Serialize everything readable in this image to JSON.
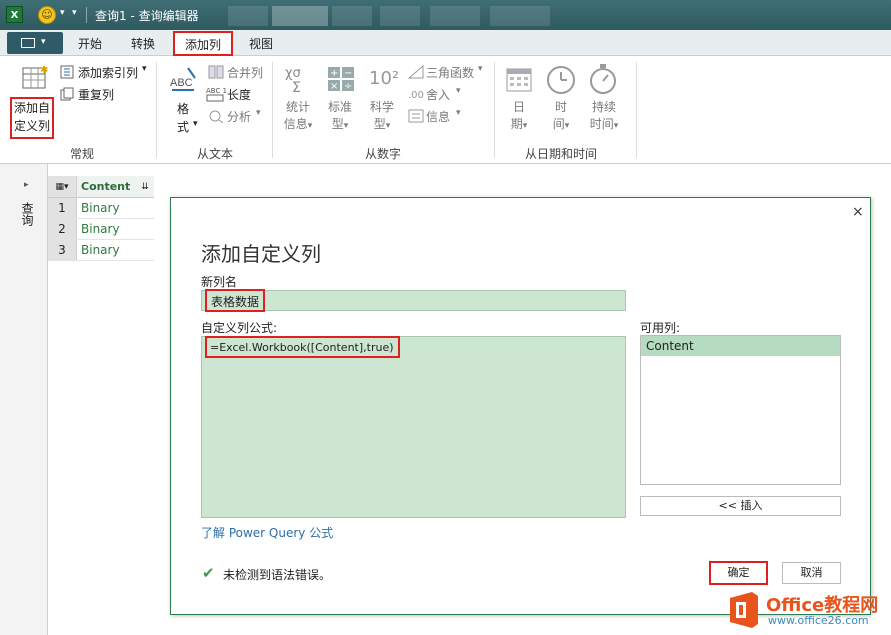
{
  "window": {
    "title": "查询1 - 查询编辑器",
    "app_icon": "X"
  },
  "tabs": [
    {
      "label": "开始"
    },
    {
      "label": "转换"
    },
    {
      "label": "添加列"
    },
    {
      "label": "视图"
    }
  ],
  "ribbon": {
    "general": {
      "group_label": "常规",
      "add_custom_line1": "添加自",
      "add_custom_line2": "定义列",
      "add_index": "添加索引列",
      "duplicate": "重复列"
    },
    "from_text": {
      "group_label": "从文本",
      "format_line1": "格",
      "format_line2": "式",
      "merge": "合并列",
      "length": "长度",
      "analyze": "分析",
      "abc_glyph": "ABC",
      "abc123_glyph": "ABC 123"
    },
    "from_number": {
      "group_label": "从数字",
      "stats_l1": "统计",
      "stats_l2": "信息",
      "standard_l1": "标准",
      "standard_l2": "型",
      "sci_l1": "科学",
      "sci_l2": "型",
      "trig": "三角函数",
      "round": "舍入",
      "info": "信息",
      "sci_glyph": "10²"
    },
    "from_date": {
      "group_label": "从日期和时间",
      "date_l1": "日",
      "date_l2": "期",
      "time_l1": "时",
      "time_l2": "间",
      "dur_l1": "持续",
      "dur_l2": "时间"
    }
  },
  "left_nav": {
    "label": "查询"
  },
  "grid": {
    "header": "Content",
    "rows": [
      {
        "num": "1",
        "value": "Binary"
      },
      {
        "num": "2",
        "value": "Binary"
      },
      {
        "num": "3",
        "value": "Binary"
      }
    ]
  },
  "dialog": {
    "title": "添加自定义列",
    "close": "×",
    "new_col_label": "新列名",
    "new_col_value": "表格数据",
    "formula_label": "自定义列公式:",
    "formula_value": "=Excel.Workbook([Content],true)",
    "available_label": "可用列:",
    "available_items": [
      "Content"
    ],
    "insert_button": "<< 插入",
    "learn_link": "了解 Power Query 公式",
    "status_text": "未检测到语法错误。",
    "ok_button": "确定",
    "cancel_button": "取消"
  },
  "watermark": {
    "brand": "Office教程网",
    "url": "www.office26.com"
  },
  "colors": {
    "accent_green": "#2e7d4f",
    "field_green": "#cde6d2",
    "highlight_red": "#e02020",
    "logo_orange": "#e8541c"
  }
}
